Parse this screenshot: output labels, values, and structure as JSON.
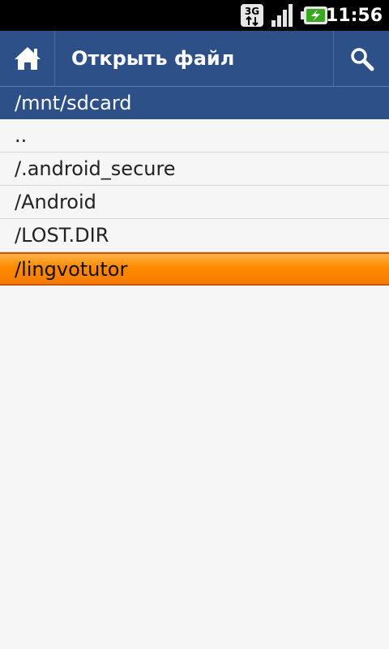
{
  "status_bar": {
    "network_label": "3G",
    "time": "11:56",
    "icons": [
      "3g-data-icon",
      "signal-strength-icon",
      "battery-charging-icon"
    ]
  },
  "app_bar": {
    "title": "Открыть файл",
    "home_icon": "home-icon",
    "search_icon": "search-icon",
    "colors": {
      "bar": "#2d5089",
      "selected": "#ff8a00"
    }
  },
  "path_bar": {
    "current_path": "/mnt/sdcard"
  },
  "files": [
    {
      "name": "..",
      "selected": false
    },
    {
      "name": "/.android_secure",
      "selected": false
    },
    {
      "name": "/Android",
      "selected": false
    },
    {
      "name": "/LOST.DIR",
      "selected": false
    },
    {
      "name": "/lingvotutor",
      "selected": true
    }
  ]
}
